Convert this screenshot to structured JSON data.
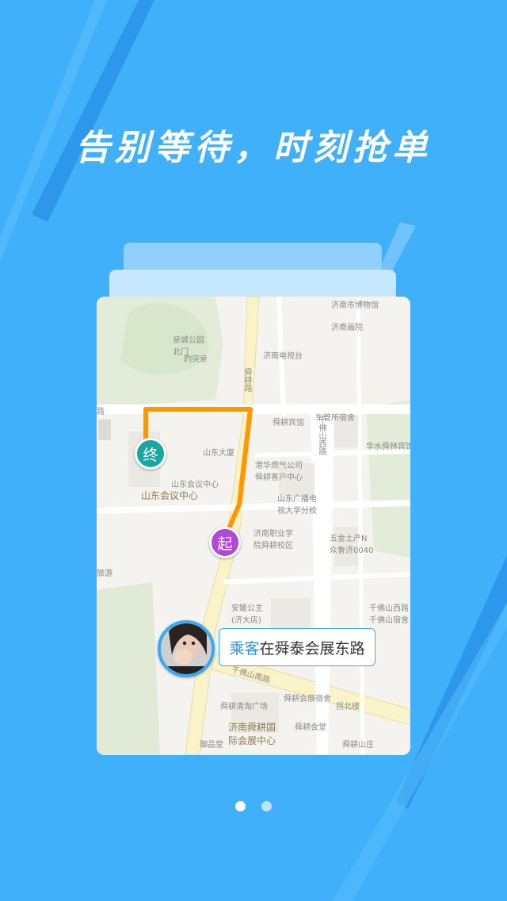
{
  "headline": "告别等待，时刻抢单",
  "map": {
    "end_marker": "终",
    "start_marker": "起",
    "route_color": "#ff9800",
    "labels": {
      "l1": "济南市博物馆",
      "l2": "济南画院",
      "l3": "济南电视台",
      "l4": "舜耕路",
      "l5": "舜耕宾馆",
      "l6": "车管所宿舍",
      "l7": "山东大厦",
      "l8": "山东会议中心",
      "l9": "山东会议中心",
      "l10": "港华燃气公司\n舜耕客户中心",
      "l11": "山东广播电\n视大学分校",
      "l12": "济南职业学\n院舜耕校区",
      "l13": "千佛山西路",
      "l14": "安媛公主\n(济大店)",
      "l15": "千佛山南路",
      "l16": "舜耕会展宿舍",
      "l17": "济南舜耕国\n际会展中心",
      "l18": "舜耕会堂",
      "l19": "舜耕山庄",
      "l20": "御品堂",
      "l21": "舜耕清淘广场",
      "l22": "山东会议中心",
      "l23": "旅游",
      "l24": "千佛山西路\n千佛山宿舍",
      "l25": "五金土产N\n众鲁济0040",
      "l26": "华水舜林宾馆",
      "l27": "泉城公园\n北门",
      "l28": "拐北楼",
      "l29": "趵突泉",
      "l30": "路"
    }
  },
  "passenger": {
    "who": "乘客",
    "location_text": "在舜泰会展东路"
  },
  "pager": {
    "count": 2,
    "active_index": 0
  }
}
